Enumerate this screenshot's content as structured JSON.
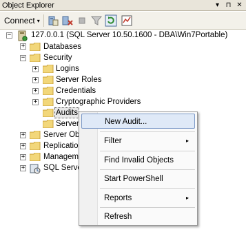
{
  "window": {
    "title": "Object Explorer",
    "buttons": [
      "▾",
      "⊓",
      "✕"
    ]
  },
  "toolbar": {
    "connect_label": "Connect",
    "connect_caret": "▾",
    "icons": [
      "connect-server-icon",
      "disconnect-icon",
      "stop-icon",
      "filter-icon",
      "refresh-icon",
      "activity-monitor-icon"
    ]
  },
  "tree": {
    "server": {
      "label": "127.0.0.1 (SQL Server 10.50.1600 - DBA\\Win7Portable)",
      "expander": "−"
    },
    "databases": {
      "label": "Databases",
      "expander": "+"
    },
    "security": {
      "label": "Security",
      "expander": "−"
    },
    "logins": {
      "label": "Logins",
      "expander": "+"
    },
    "server_roles": {
      "label": "Server Roles",
      "expander": "+"
    },
    "credentials": {
      "label": "Credentials",
      "expander": "+"
    },
    "crypto": {
      "label": "Cryptographic Providers",
      "expander": "+"
    },
    "audits": {
      "label": "Audits"
    },
    "server_audit_specs": {
      "label": "Server"
    },
    "server_objects": {
      "label": "Server Obj",
      "expander": "+"
    },
    "replication": {
      "label": "Replication",
      "expander": "+"
    },
    "management": {
      "label": "Manageme",
      "expander": "+"
    },
    "sql_agent": {
      "label": "SQL Server",
      "expander": "+"
    }
  },
  "context_menu": {
    "items": [
      {
        "label": "New Audit...",
        "highlighted": true
      },
      {
        "label": "Filter",
        "submenu": "▸"
      },
      {
        "label": "Find Invalid Objects"
      },
      {
        "label": "Start PowerShell"
      },
      {
        "label": "Reports",
        "submenu": "▸"
      },
      {
        "label": "Refresh"
      }
    ]
  },
  "colors": {
    "folder": "#f2d77a",
    "folder_dark": "#c9a23a",
    "highlight": "#dfe9f7"
  }
}
